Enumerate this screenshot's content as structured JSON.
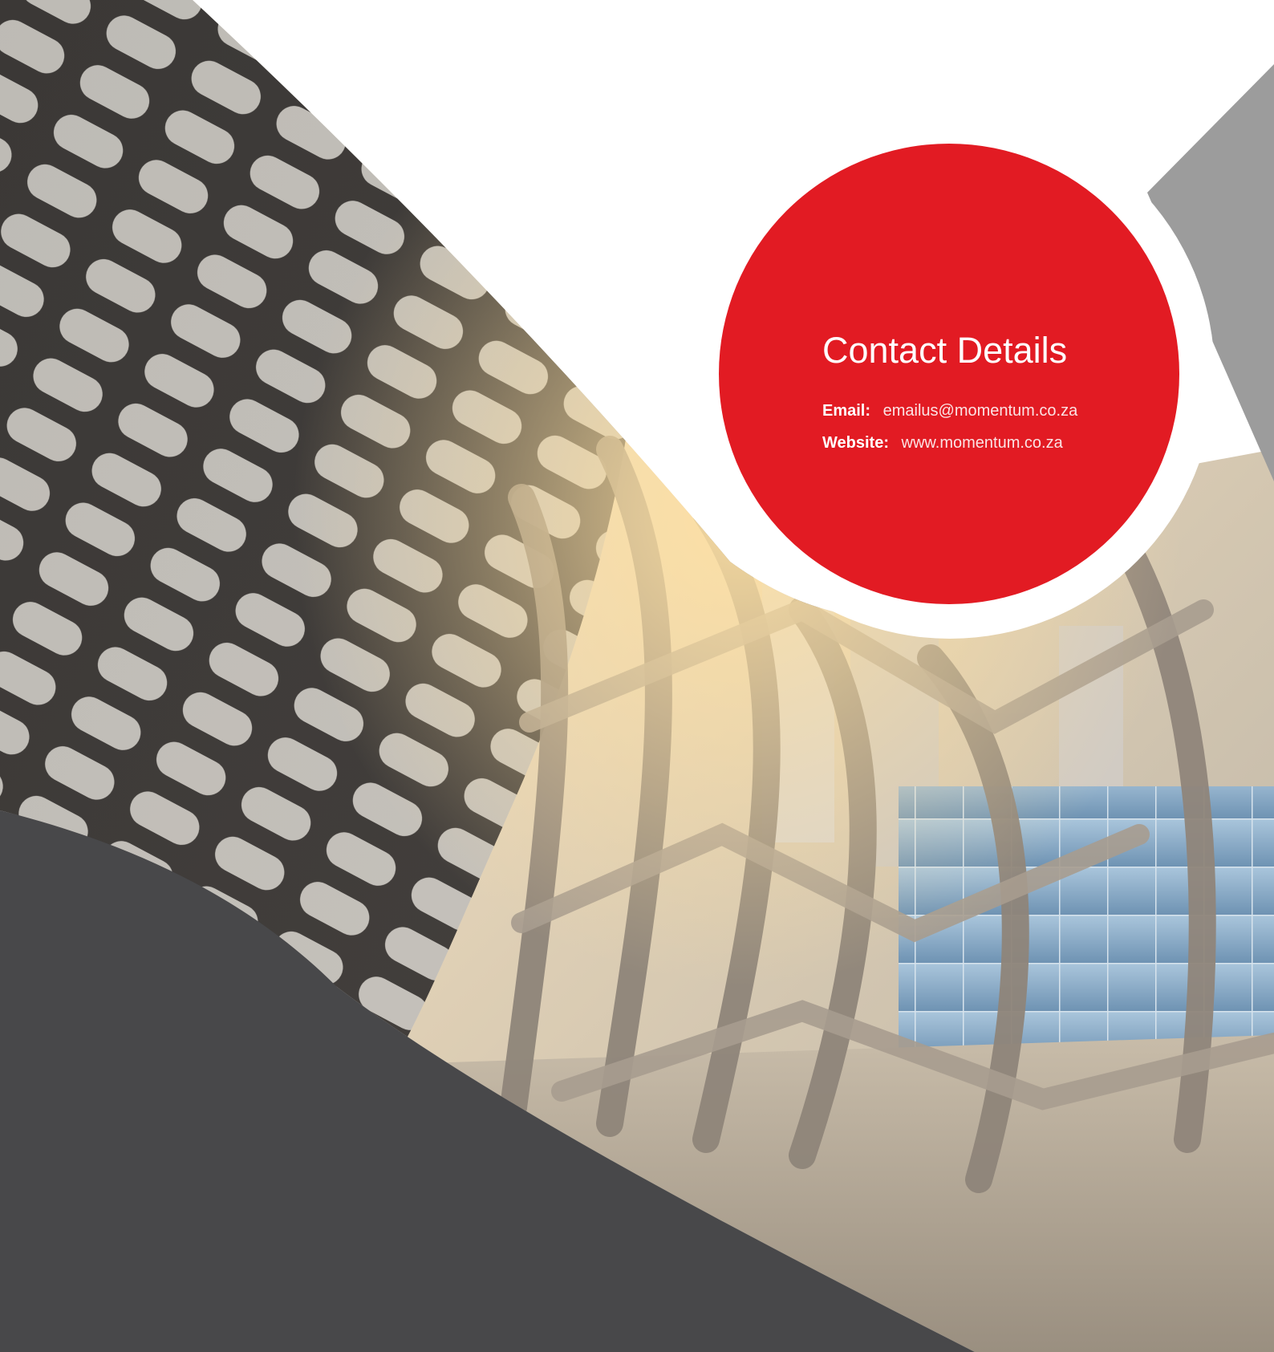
{
  "colors": {
    "brand_red": "#e21b23",
    "dark_band": "#48484a",
    "background": "#ffffff",
    "corner_grey": "#9c9c9c"
  },
  "contact": {
    "title": "Contact Details",
    "email_label": "Email:",
    "email_value": "emailus@momentum.co.za",
    "website_label": "Website:",
    "website_value": "www.momentum.co.za"
  }
}
